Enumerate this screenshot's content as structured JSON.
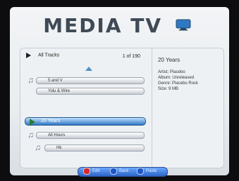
{
  "app": {
    "title": "MEDIA TV"
  },
  "list": {
    "header_label": "All Tracks",
    "count": "1 of 190",
    "items": [
      {
        "label": "5 and V"
      },
      {
        "label": "Yolu & Wire"
      },
      {
        "label": "20 Years",
        "selected": true
      },
      {
        "label": "All Hours"
      },
      {
        "label": "Hk"
      }
    ]
  },
  "details": {
    "title": "20 Years",
    "artist": "Artist: Placebo",
    "album": "Album: Unreleased",
    "genre": "Genre: Placebo Rock",
    "size": "Size: 9 MB"
  },
  "bottom_bar": {
    "buttons": [
      {
        "label": "Edit",
        "color": "#d12b2b"
      },
      {
        "label": "Back",
        "color": "#1f57c7"
      },
      {
        "label": "Paste",
        "color": "#1f57c7"
      }
    ]
  },
  "colors": {
    "accent": "#2f78c4",
    "play": "#2e7a31",
    "text": "#333333"
  }
}
